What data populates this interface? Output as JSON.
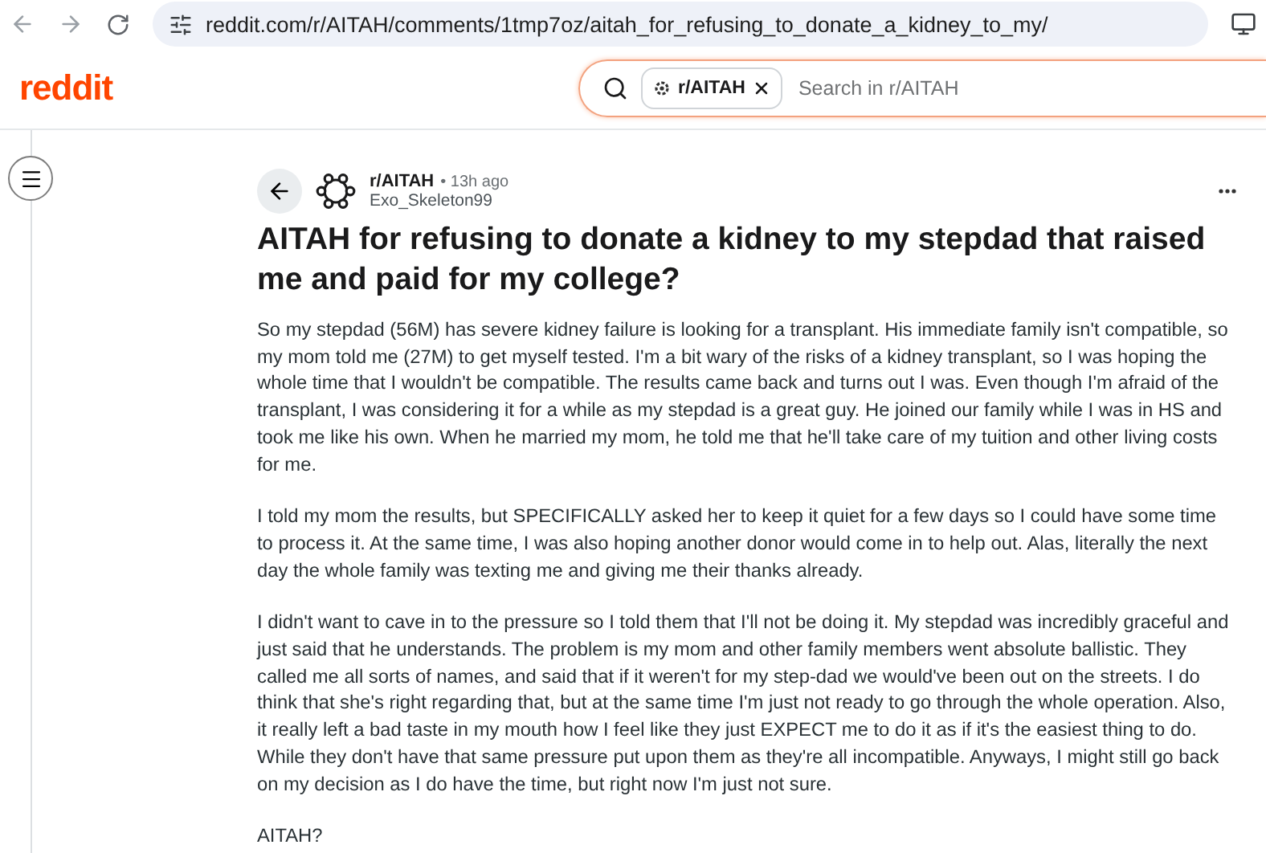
{
  "browser": {
    "url": "reddit.com/r/AITAH/comments/1tmp7oz/aitah_for_refusing_to_donate_a_kidney_to_my/"
  },
  "header": {
    "logo": "reddit",
    "search": {
      "chip": "r/AITAH",
      "placeholder": "Search in r/AITAH"
    }
  },
  "post": {
    "subreddit": "r/AITAH",
    "time": "• 13h ago",
    "author": "Exo_Skeleton99",
    "title": "AITAH for refusing to donate a kidney to my stepdad that raised me and paid for my college?",
    "paragraphs": [
      "So my stepdad (56M) has severe kidney failure is looking for a transplant. His immediate family isn't compatible, so my mom told me (27M) to get myself tested. I'm a bit wary of the risks of a kidney transplant, so I was hoping the whole time that I wouldn't be compatible. The results came back and turns out I was. Even though I'm afraid of the transplant, I was considering it for a while as my stepdad is a great guy. He joined our family while I was in HS and took me like his own. When he married my mom, he told me that he'll take care of my tuition and other living costs for me.",
      "I told my mom the results, but SPECIFICALLY asked her to keep it quiet for a few days so I could have some time to process it. At the same time, I was also hoping another donor would come in to help out. Alas, literally the next day the whole family was texting me and giving me their thanks already.",
      "I didn't want to cave in to the pressure so I told them that I'll not be doing it. My stepdad was incredibly graceful and just said that he understands. The problem is my mom and other family members went absolute ballistic. They called me all sorts of names, and said that if it weren't for my step-dad we would've been out on the streets. I do think that she's right regarding that, but at the same time I'm just not ready to go through the whole operation. Also, it really left a bad taste in my mouth how I feel like they just EXPECT me to do it as if it's the easiest thing to do. While they don't have that same pressure put upon them as they're all incompatible. Anyways, I might still go back on my decision as I do have the time, but right now I'm just not sure.",
      "AITAH?"
    ]
  }
}
